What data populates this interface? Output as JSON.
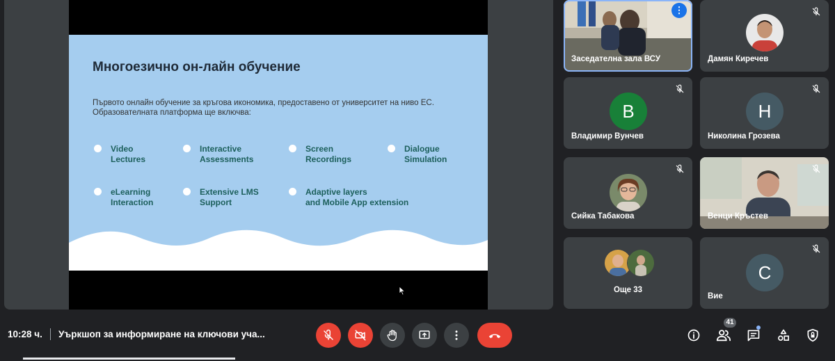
{
  "slide": {
    "title": "Многоезично он-лайн обучение",
    "intro": "Първото онлайн обучение за кръгова икономика, предоставено от университет на ниво ЕС. Образователната платформа ще включва:",
    "features": [
      "Video\nLectures",
      "Interactive\nAssessments",
      "Screen\nRecordings",
      "Dialogue\nSimulation",
      "eLearning\nInteraction",
      "Extensive LMS\nSupport",
      "Adaptive layers\nand Mobile App extension"
    ]
  },
  "participants": [
    {
      "name": "Заседателна зала ВСУ",
      "type": "video"
    },
    {
      "name": "Дамян Киречев",
      "type": "photo"
    },
    {
      "name": "Владимир Вунчев",
      "type": "letter",
      "letter": "В",
      "color": "#188038"
    },
    {
      "name": "Николина Грозева",
      "type": "letter",
      "letter": "Н",
      "color": "#455a64"
    },
    {
      "name": "Сийка Табакова",
      "type": "photo"
    },
    {
      "name": "Венци Кръстев",
      "type": "video"
    },
    {
      "name": "Още 33",
      "type": "group"
    },
    {
      "name": "Вие",
      "type": "letter",
      "letter": "С",
      "color": "#455a64"
    }
  ],
  "bar": {
    "time": "10:28 ч.",
    "meeting_title": "Уъркшоп за информиране на ключови уча...",
    "people_count": "41"
  },
  "icons": {
    "mic": "mic-off-icon",
    "camera": "camera-off-icon",
    "hand": "raise-hand-icon",
    "present": "present-screen-icon",
    "more": "more-options-icon",
    "hangup": "hang-up-icon",
    "info": "info-icon",
    "people": "people-icon",
    "chat": "chat-icon",
    "activities": "activities-icon",
    "host": "host-controls-icon"
  },
  "colors": {
    "red": "#ea4335",
    "surface": "#3c4043",
    "background": "#202124",
    "slide": "#a5cdef"
  }
}
